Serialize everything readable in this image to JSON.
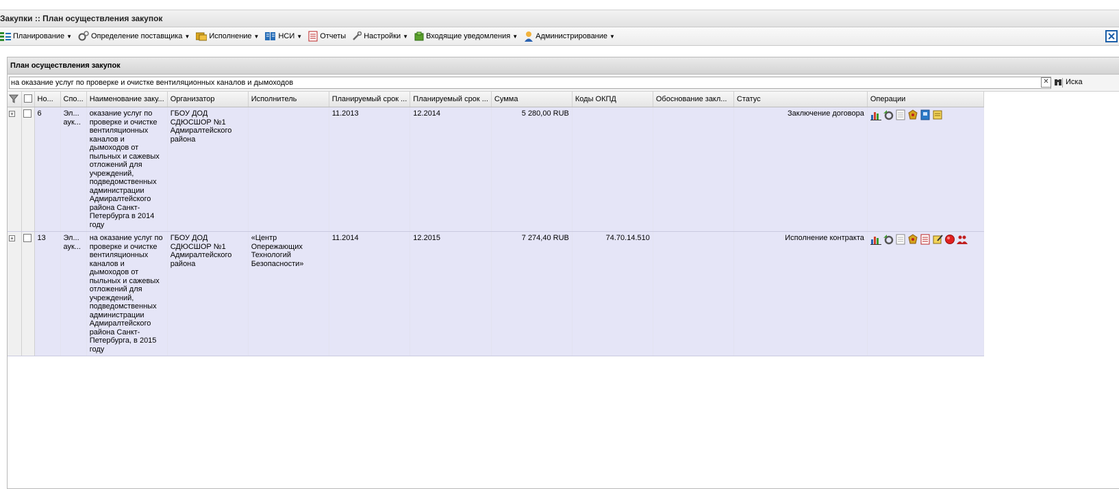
{
  "app": {
    "title": "Закупки :: План осуществления закупок"
  },
  "menu": {
    "items": [
      {
        "label": "Планирование",
        "dropdown": true
      },
      {
        "label": "Определение поставщика",
        "dropdown": true
      },
      {
        "label": "Исполнение",
        "dropdown": true
      },
      {
        "label": "НСИ",
        "dropdown": true
      },
      {
        "label": "Отчеты",
        "dropdown": false
      },
      {
        "label": "Настройки",
        "dropdown": true
      },
      {
        "label": "Входящие уведомления",
        "dropdown": true
      },
      {
        "label": "Администрирование",
        "dropdown": true
      }
    ]
  },
  "panel": {
    "title": "План осуществления закупок"
  },
  "search": {
    "value": "на оказание услуг по проверке и очистке вентиляционных каналов и дымоходов",
    "button_label": "Иска"
  },
  "grid": {
    "columns": [
      "Но...",
      "Спо...",
      "Наименование заку...",
      "Организатор",
      "Исполнитель",
      "Планируемый срок ...",
      "Планируемый срок ...",
      "Сумма",
      "Коды ОКПД",
      "Обоснование закл...",
      "Статус",
      "Операции"
    ],
    "rows": [
      {
        "number": "6",
        "method": "Эл... аук...",
        "name": "оказание услуг по проверке и очистке вентиляционных каналов и дымоходов от пыльных и сажевых отложений для учреждений, подведомственных администрации Адмиралтейского района Санкт-Петербурга в 2014 году",
        "organizer": "ГБОУ ДОД СДЮСШОР №1 Адмиралтейского района",
        "executor": "",
        "planned_start": "11.2013",
        "planned_end": "12.2014",
        "amount": "5 280,00 RUB",
        "okpd": "",
        "justification": "",
        "status": "Заключение договора",
        "operations": [
          "chart-icon",
          "gear-refresh-icon",
          "document-icon",
          "emblem-icon",
          "book-icon",
          "scroll-icon"
        ]
      },
      {
        "number": "13",
        "method": "Эл... аук...",
        "name": "на оказание услуг по проверке и очистке вентиляционных каналов и дымоходов от пыльных и сажевых отложений для учреждений, подведомственных администрации Адмиралтейского района Санкт-Петербурга, в 2015 году",
        "organizer": "ГБОУ ДОД СДЮСШОР №1 Адмиралтейского района",
        "executor": "«Центр Опережающих Технологий Безопасности»",
        "planned_start": "11.2014",
        "planned_end": "12.2015",
        "amount": "7 274,40 RUB",
        "okpd": "74.70.14.510",
        "justification": "",
        "status": "Исполнение контракта",
        "operations": [
          "chart-icon",
          "gear-refresh-icon",
          "document-icon",
          "emblem-icon",
          "report-icon",
          "edit-scroll-icon",
          "red-circle-icon",
          "users-icon"
        ]
      }
    ]
  },
  "colors": {
    "row_background": "#e5e5f7",
    "header_background": "#e5e5e5"
  }
}
